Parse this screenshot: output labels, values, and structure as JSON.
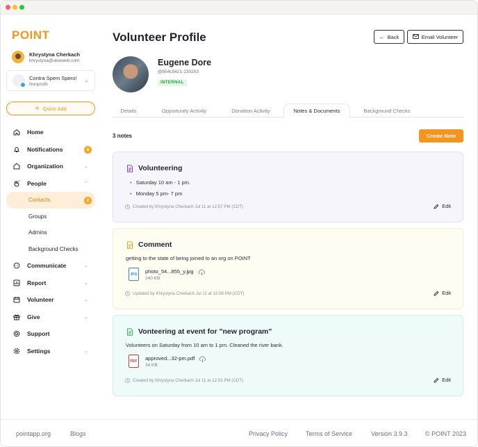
{
  "brand": {
    "logo": "POINT",
    "accent": "#f5951f"
  },
  "user": {
    "name": "Khrystyna Cherkach",
    "email": "khrystyna@ukieweb.com"
  },
  "org": {
    "name": "Contra Spem Spero!",
    "type": "Nonprofit"
  },
  "quick_add": {
    "label": "Quick Add"
  },
  "nav": {
    "home": "Home",
    "notifications": {
      "label": "Notifications",
      "count": "8"
    },
    "organization": "Organization",
    "people": "People",
    "people_sub": {
      "contacts": {
        "label": "Contacts",
        "count": "2"
      },
      "groups": "Groups",
      "admins": "Admins",
      "background_checks": "Background Checks"
    },
    "communicate": "Communicate",
    "report": "Report",
    "volunteer": "Volunteer",
    "give": "Give",
    "support": "Support",
    "settings": "Settings"
  },
  "header": {
    "title": "Volunteer Profile",
    "back_label": "Back",
    "email_label": "Email Volunteer"
  },
  "profile": {
    "name": "Eugene Dore",
    "id": "@854c5421-230203",
    "tag": "INTERNAL"
  },
  "tabs": [
    {
      "label": "Details"
    },
    {
      "label": "Opportunity Activity"
    },
    {
      "label": "Donation Activity"
    },
    {
      "label": "Notes & Documents"
    },
    {
      "label": "Background Checks"
    }
  ],
  "notes": {
    "count_label": "3 notes",
    "create_label": "Create Note",
    "items": [
      {
        "title": "Volunteering",
        "bullets": [
          "Saturday 10 am - 1 pm.",
          "Monday 5 pm- 7 pm"
        ],
        "meta": "Created by Khrystyna Cherkach Jul 11 at 12:57 PM (CDT)",
        "edit_label": "Edit",
        "icon_color": "#8b3fc6"
      },
      {
        "title": "Comment",
        "description": "getting to the state of being joined to an org on POINT",
        "attachment": {
          "name": "photo_54...855_y.jpg",
          "size": "240 KB",
          "type": "JPG"
        },
        "meta": "Updated by Khrystyna Cherkach Jul 11 at 12:56 PM (CDT)",
        "edit_label": "Edit",
        "icon_color": "#e6a817"
      },
      {
        "title": "Vonteering at event for \"new program\"",
        "description": "Volunteers on Saturday from 10 am to 1 pm. Cleaned the river bank.",
        "attachment": {
          "name": "approved...32-pm.pdf",
          "size": "34 KB",
          "type": "PDF"
        },
        "meta": "Created by Khrystyna Cherkach Jul 11 at 12:53 PM (CDT)",
        "edit_label": "Edit",
        "icon_color": "#2fb56c"
      }
    ]
  },
  "footer": {
    "site": "pointapp.org",
    "blogs": "Blogs",
    "privacy": "Privacy Policy",
    "terms": "Terms of Service",
    "version": "Version 3.9.3",
    "copyright": "© POINT 2023"
  }
}
